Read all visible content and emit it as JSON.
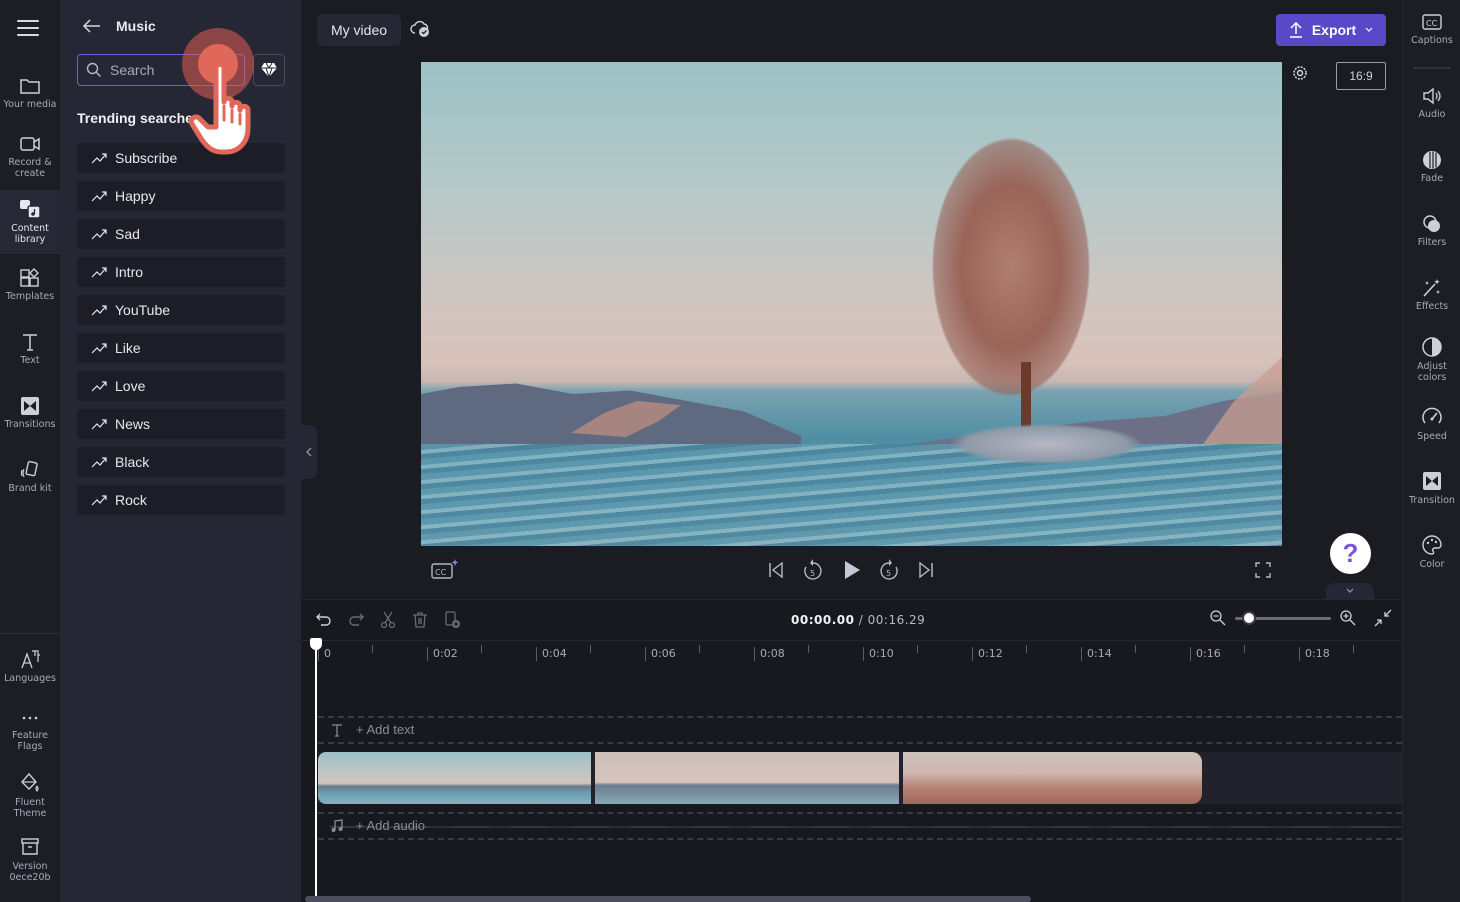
{
  "app": {
    "project_title": "My video",
    "export_label": "Export",
    "aspect_ratio": "16:9",
    "help_glyph": "?"
  },
  "left_rail": {
    "items": [
      {
        "id": "your-media",
        "label": "Your media",
        "icon": "folder-icon"
      },
      {
        "id": "record-create",
        "label": "Record & create",
        "icon": "camera-icon"
      },
      {
        "id": "content-library",
        "label": "Content library",
        "icon": "content-library-icon",
        "active": true
      },
      {
        "id": "templates",
        "label": "Templates",
        "icon": "templates-icon"
      },
      {
        "id": "text",
        "label": "Text",
        "icon": "text-icon"
      },
      {
        "id": "transitions",
        "label": "Transitions",
        "icon": "transitions-icon"
      },
      {
        "id": "brand-kit",
        "label": "Brand kit",
        "icon": "brand-kit-icon"
      }
    ],
    "bottom_items": [
      {
        "id": "languages",
        "label": "Languages",
        "icon": "languages-icon"
      },
      {
        "id": "feature-flags",
        "label": "Feature Flags",
        "icon": "more-icon"
      },
      {
        "id": "fluent-theme",
        "label": "Fluent Theme",
        "icon": "paint-bucket-icon"
      },
      {
        "id": "version",
        "label": "Version 0ece20b",
        "icon": "archive-icon"
      }
    ]
  },
  "panel": {
    "title": "Music",
    "search_placeholder": "Search",
    "trending_title": "Trending searches",
    "trending": [
      "Subscribe",
      "Happy",
      "Sad",
      "Intro",
      "YouTube",
      "Like",
      "Love",
      "News",
      "Black",
      "Rock"
    ]
  },
  "right_rail": {
    "items": [
      {
        "id": "captions",
        "label": "Captions"
      },
      {
        "id": "audio",
        "label": "Audio"
      },
      {
        "id": "fade",
        "label": "Fade"
      },
      {
        "id": "filters",
        "label": "Filters"
      },
      {
        "id": "effects",
        "label": "Effects"
      },
      {
        "id": "adjust-colors",
        "label": "Adjust colors"
      },
      {
        "id": "speed",
        "label": "Speed"
      },
      {
        "id": "transition",
        "label": "Transition"
      },
      {
        "id": "color",
        "label": "Color"
      }
    ]
  },
  "timeline": {
    "current_time": "00:00.00",
    "total_time": "/ 00:16.29",
    "ruler_labels": [
      "0",
      "0:02",
      "0:04",
      "0:06",
      "0:08",
      "0:10",
      "0:12",
      "0:14",
      "0:16",
      "0:18"
    ],
    "add_text_label": "+ Add text",
    "add_audio_label": "+ Add audio",
    "zoom_level": 0.15,
    "clips": [
      "clip-1",
      "clip-2",
      "clip-3"
    ]
  },
  "colors": {
    "accent": "#5849c9",
    "search_border": "#6b5fd6",
    "background": "#1b1b22",
    "panel": "#262735"
  }
}
